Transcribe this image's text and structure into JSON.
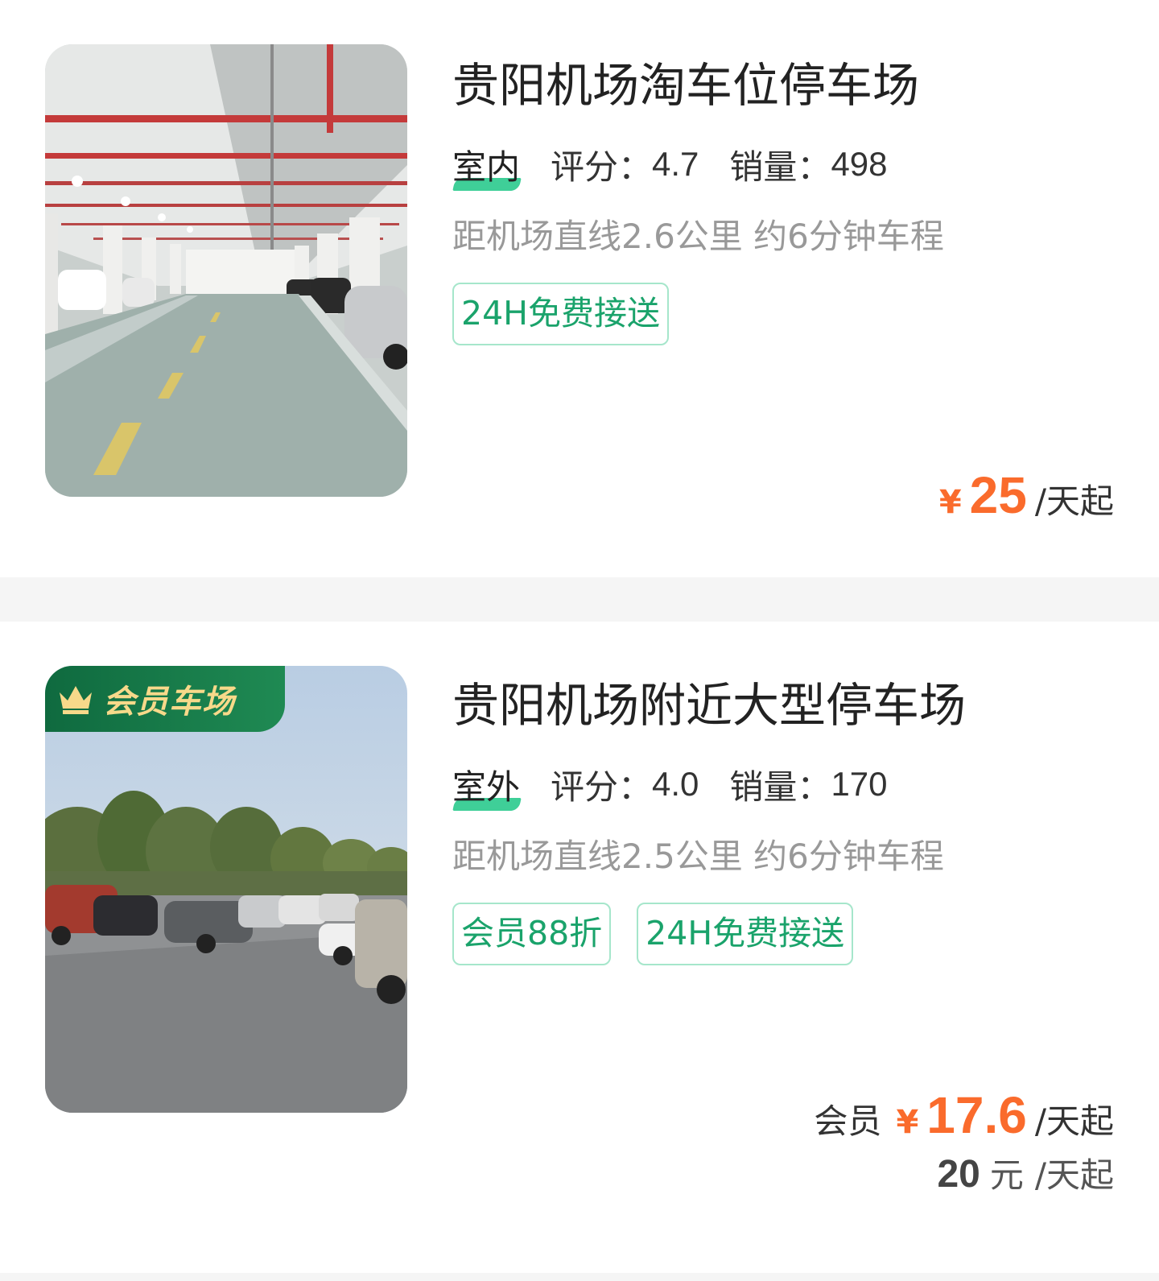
{
  "lots": [
    {
      "title": "贵阳机场淘车位停车场",
      "env": "室内",
      "rating_label": "评分：",
      "rating": "4.7",
      "sales_label": "销量：",
      "sales": "498",
      "distance": "距机场直线2.6公里 约6分钟车程",
      "tags": [
        "24H免费接送"
      ],
      "price": {
        "yen": "¥",
        "amount": "25",
        "unit": "/天起"
      },
      "image_icon": "indoor-parking-photo"
    },
    {
      "badge": "会员车场",
      "badge_icon": "crown-icon",
      "title": "贵阳机场附近大型停车场",
      "env": "室外",
      "rating_label": "评分：",
      "rating": "4.0",
      "sales_label": "销量：",
      "sales": "170",
      "distance": "距机场直线2.5公里 约6分钟车程",
      "tags": [
        "会员88折",
        "24H免费接送"
      ],
      "price": {
        "prefix": "会员",
        "yen": "¥",
        "amount": "17.6",
        "unit": "/天起"
      },
      "original_price": {
        "amount": "20",
        "yuan": "元",
        "unit": "/天起"
      },
      "image_icon": "outdoor-parking-photo"
    }
  ],
  "colors": {
    "accent_orange": "#fa6b2c",
    "tag_green": "#1aa36b",
    "tag_border": "#a6e6cb",
    "badge_green": "#0f6a3f",
    "badge_gold": "#f7d98a",
    "env_underline": "#3fcf98"
  }
}
